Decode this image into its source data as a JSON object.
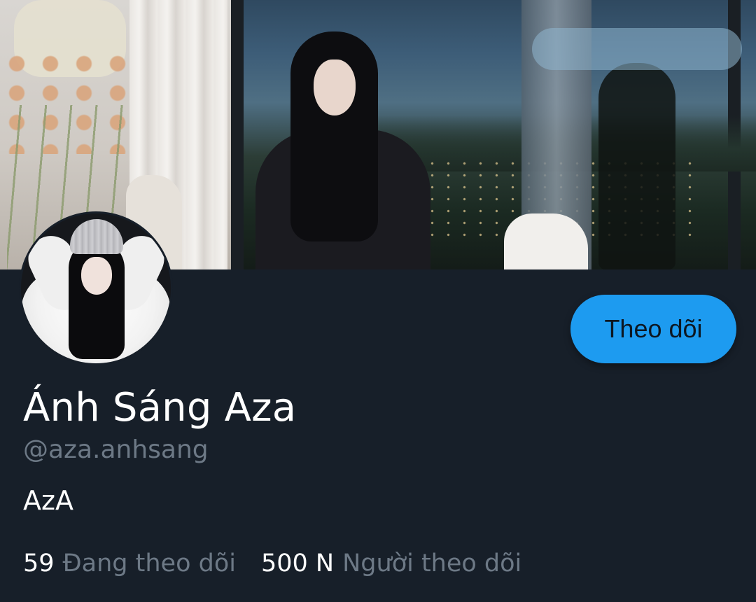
{
  "profile": {
    "display_name": "Ánh Sáng Aza",
    "handle": "@aza.anhsang",
    "bio": "AzA",
    "follow_button_label": "Theo dõi"
  },
  "stats": {
    "following_count": "59",
    "following_label": "Đang theo dõi",
    "followers_count": "500 N",
    "followers_label": "Người theo dõi"
  },
  "colors": {
    "background": "#171f29",
    "accent": "#1d9bf0",
    "primary_text": "#ffffff",
    "secondary_text": "#6d7986"
  }
}
